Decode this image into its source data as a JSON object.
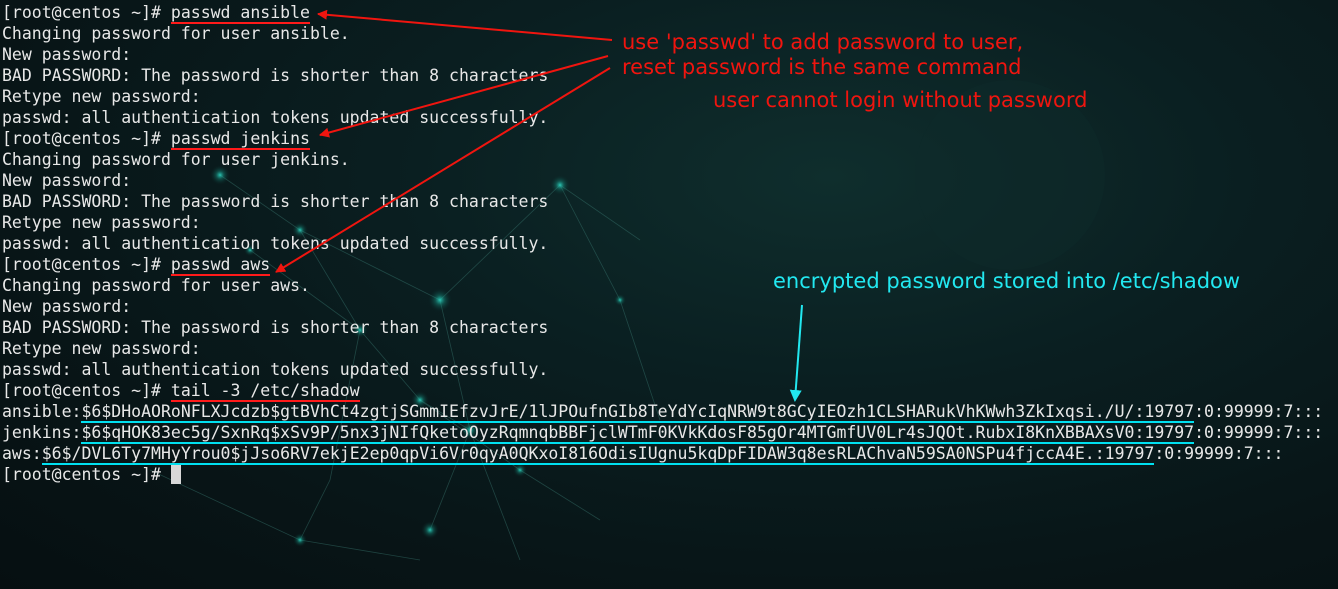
{
  "terminal": {
    "lines": [
      {
        "prompt": "[root@centos ~]# ",
        "cmd": "passwd ansible"
      },
      {
        "text": "Changing password for user ansible."
      },
      {
        "text": "New password:"
      },
      {
        "text": "BAD PASSWORD: The password is shorter than 8 characters"
      },
      {
        "text": "Retype new password:"
      },
      {
        "text": "passwd: all authentication tokens updated successfully."
      },
      {
        "prompt": "[root@centos ~]# ",
        "cmd": "passwd jenkins"
      },
      {
        "text": "Changing password for user jenkins."
      },
      {
        "text": "New password:"
      },
      {
        "text": "BAD PASSWORD: The password is shorter than 8 characters"
      },
      {
        "text": "Retype new password:"
      },
      {
        "text": "passwd: all authentication tokens updated successfully."
      },
      {
        "prompt": "[root@centos ~]# ",
        "cmd": "passwd aws"
      },
      {
        "text": "Changing password for user aws."
      },
      {
        "text": "New password:"
      },
      {
        "text": "BAD PASSWORD: The password is shorter than 8 characters"
      },
      {
        "text": "Retype new password:"
      },
      {
        "text": "passwd: all authentication tokens updated successfully."
      },
      {
        "prompt": "[root@centos ~]# ",
        "cmd": "tail -3 /etc/shadow"
      },
      {
        "user": "ansible:",
        "hash": "$6$DHoAORoNFLXJcdzb$gtBVhCt4zgtjSGmmIEfzvJrE/1lJPOufnGIb8TeYdYcIqNRW9t8GCyIEOzh1CLSHARukVhKWwh3ZkIxqsi./U/:19797",
        "rest": ":0:99999:7:::"
      },
      {
        "user": "jenkins:",
        "hash": "$6$qHOK83ec5g/SxnRq$xSv9P/5nx3jNIfQketoOyzRqmnqbBBFjclWTmF0KVkKdosF85gOr4MTGmfUV0Lr4sJQOt.RubxI8KnXBBAXsV0:19797",
        "rest": ":0:99999:7:::"
      },
      {
        "user": "aws:",
        "hash": "$6$/DVL6Ty7MHyYrou0$jJso6RV7ekjE2ep0qpVi6Vr0qyA0QKxoI816OdisIUgnu5kqDpFIDAW3q8esRLAChvaN59SA0NSPu4fjccA4E.:19797",
        "rest": ":0:99999:7:::"
      },
      {
        "prompt": "[root@centos ~]# ",
        "cursor": true
      }
    ]
  },
  "annotations": {
    "note1": "use 'passwd' to add password to user,",
    "note2": "reset password is the same command",
    "note3": "user cannot login without password",
    "note4": "encrypted password stored into /etc/shadow"
  },
  "colors": {
    "annotation_red": "#f0150f",
    "annotation_cyan": "#22e8f0",
    "terminal_text": "#e8e8e8",
    "background": "#0a1f21"
  }
}
